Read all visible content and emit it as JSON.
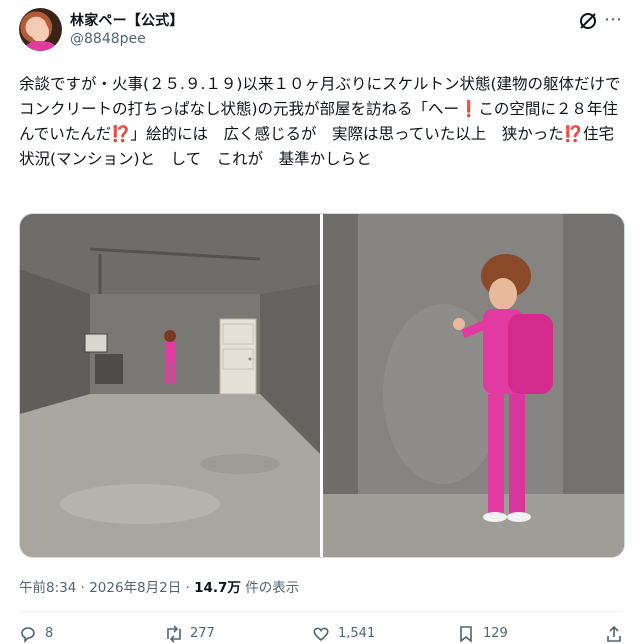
{
  "author": {
    "display_name": "林家ペー【公式】",
    "handle": "@8848pee"
  },
  "tweet": {
    "text": "余談ですが・火事(２５.９.１９)以来１０ヶ月ぶりにスケルトン状態(建物の躯体だけでコンクリートの打ちっぱなし状態)の元我が部屋を訪ねる「へー❗️この空間に２８年住んでいたんだ⁉️」絵的には　広く感じるが　実際は思っていた以上　狭かった⁉️住宅状況(マンション)と　して　これが　基準かしらと"
  },
  "media": {
    "images": [
      {
        "icon": "photo-empty-room"
      },
      {
        "icon": "photo-woman-at-wall"
      }
    ]
  },
  "meta": {
    "timestamp": "午前8:34 · 2026年8月2日 · ",
    "views": "14.7万",
    "views_suffix": " 件の表示"
  },
  "actions": {
    "reply_count": "8",
    "retweet_count": "277",
    "like_count": "1,541",
    "bookmark_count": "129"
  },
  "colors": {
    "muted": "#536471",
    "text": "#0f1419",
    "pink": "#e13aa0"
  }
}
